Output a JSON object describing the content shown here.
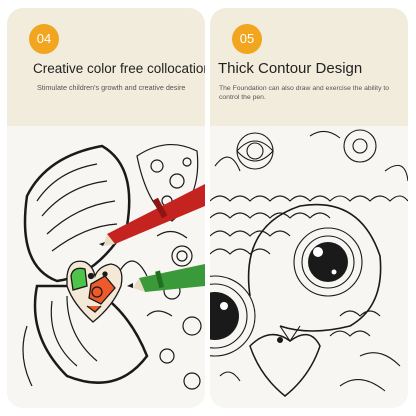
{
  "panels": [
    {
      "number": "04",
      "title": "Creative color free collocation",
      "description": "Stimulate children's growth and creative desire",
      "illustration_icon": "butterfly-coloring-with-markers",
      "badge_color": "#f2a51f"
    },
    {
      "number": "05",
      "title": "Thick Contour Design",
      "description": "The Foundation can also draw and exercise the ability to control the pen.",
      "illustration_icon": "owl-coloring-page",
      "badge_color": "#f2a51f"
    }
  ]
}
